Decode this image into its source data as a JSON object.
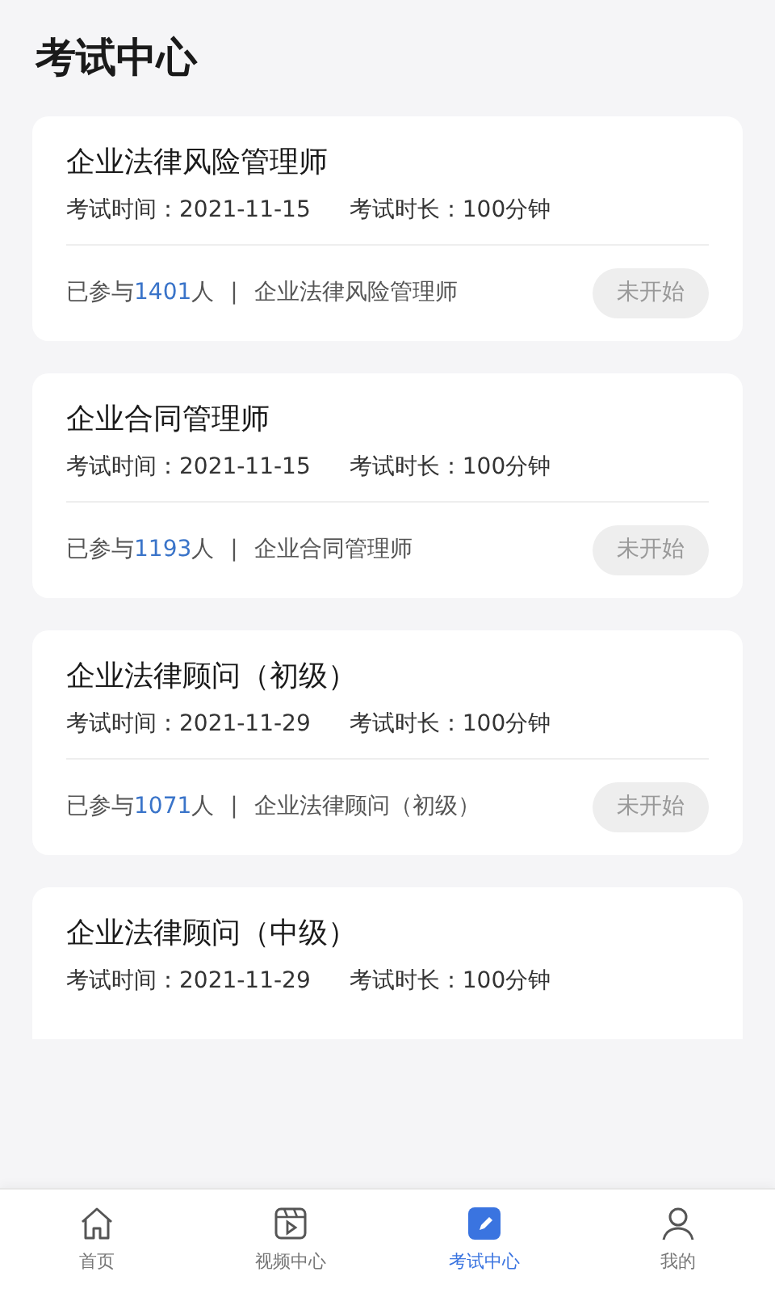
{
  "header": {
    "title": "考试中心"
  },
  "exams": [
    {
      "title": "企业法律风险管理师",
      "date_label": "考试时间：",
      "date": "2021-11-15",
      "duration_label": "考试时长：",
      "duration": "100分钟",
      "participants": {
        "prefix": "已参与",
        "count": "1401",
        "suffix": "人"
      },
      "separator": "|",
      "category": "企业法律风险管理师",
      "status": "未开始"
    },
    {
      "title": "企业合同管理师",
      "date_label": "考试时间：",
      "date": "2021-11-15",
      "duration_label": "考试时长：",
      "duration": "100分钟",
      "participants": {
        "prefix": "已参与",
        "count": "1193",
        "suffix": "人"
      },
      "separator": "|",
      "category": "企业合同管理师",
      "status": "未开始"
    },
    {
      "title": "企业法律顾问（初级）",
      "date_label": "考试时间：",
      "date": "2021-11-29",
      "duration_label": "考试时长：",
      "duration": "100分钟",
      "participants": {
        "prefix": "已参与",
        "count": "1071",
        "suffix": "人"
      },
      "separator": "|",
      "category": "企业法律顾问（初级）",
      "status": "未开始"
    },
    {
      "title": "企业法律顾问（中级）",
      "date_label": "考试时间：",
      "date": "2021-11-29",
      "duration_label": "考试时长：",
      "duration": "100分钟"
    }
  ],
  "tab_bar": [
    {
      "kind": "home",
      "label": "首页",
      "selected": false
    },
    {
      "kind": "video",
      "label": "视频中心",
      "selected": false
    },
    {
      "kind": "exam",
      "label": "考试中心",
      "selected": true
    },
    {
      "kind": "profile",
      "label": "我的",
      "selected": false
    }
  ]
}
